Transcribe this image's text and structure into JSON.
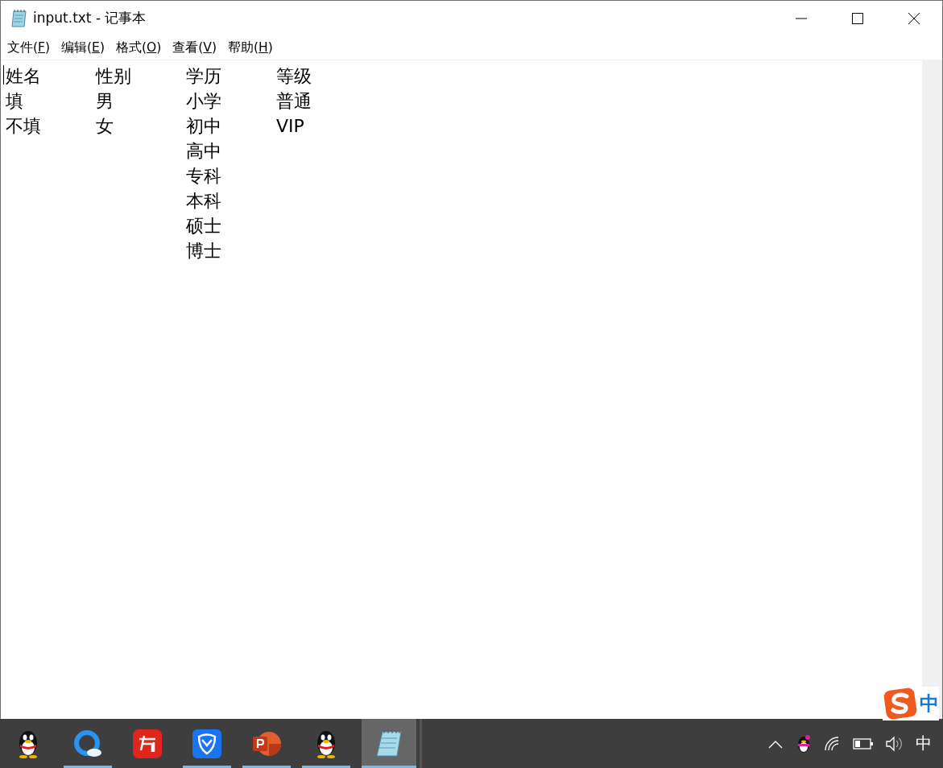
{
  "window": {
    "title": "input.txt - 记事本"
  },
  "menu": [
    {
      "label": "文件(F)"
    },
    {
      "label": "编辑(E)"
    },
    {
      "label": "格式(O)"
    },
    {
      "label": "查看(V)"
    },
    {
      "label": "帮助(H)"
    }
  ],
  "editor": {
    "lines": [
      "姓名\t性别\t学历\t等级",
      "填\t男\t小学\t普通",
      "不填\t女\t初中\tVIP",
      "\t\t高中",
      "\t\t专科",
      "\t\t本科",
      "\t\t硕士",
      "\t\t博士"
    ]
  },
  "ime": {
    "mode": "中"
  },
  "taskbar": {
    "apps": [
      {
        "kind": "penguin",
        "running": false,
        "selected": false
      },
      {
        "kind": "browser",
        "running": true,
        "selected": false
      },
      {
        "kind": "dictionary",
        "running": false,
        "selected": false
      },
      {
        "kind": "shield",
        "running": true,
        "selected": false
      },
      {
        "kind": "slides",
        "running": true,
        "selected": false
      },
      {
        "kind": "penguin",
        "running": true,
        "selected": false
      },
      {
        "kind": "notepad",
        "running": true,
        "selected": true
      }
    ],
    "tray_input": "中"
  }
}
